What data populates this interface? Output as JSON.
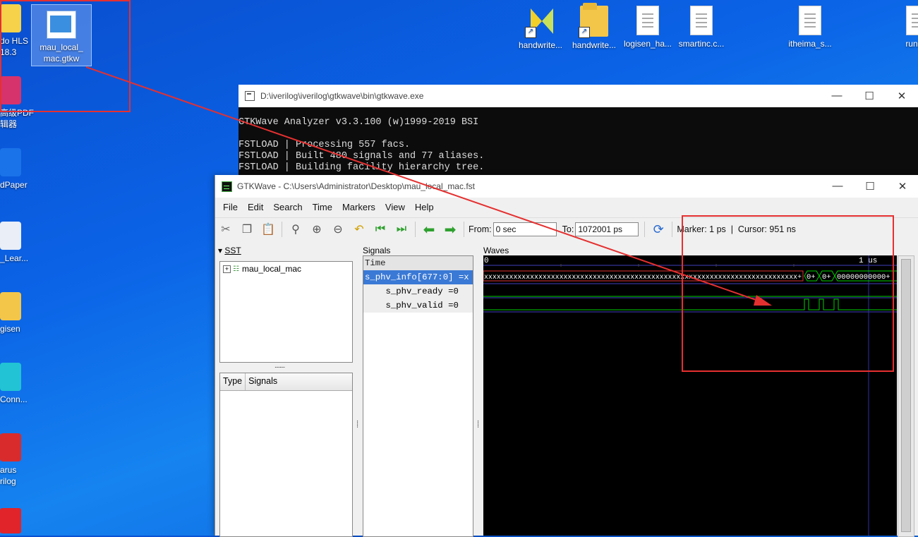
{
  "desktop": {
    "left_edge_icons": [
      {
        "label": "do HLS\n18.3",
        "color": "#f5d24a"
      },
      {
        "label": "高级PDF\n辑器",
        "color": "#d6336c"
      },
      {
        "label": "dPaper",
        "color": "#1a73e8"
      },
      {
        "label": "_Lear...",
        "color": "#e9eef7"
      },
      {
        "label": "gisen",
        "color": "#f3c64a"
      },
      {
        "label": "Conn...",
        "color": "#22c3d4"
      },
      {
        "label": "arus\nrilog",
        "color": "#d92b2b"
      }
    ],
    "selected_icon": {
      "label": "mau_local_\nmac.gtkw"
    },
    "top_icons": [
      {
        "label": "handwrite...",
        "kind": "app"
      },
      {
        "label": "handwrite...",
        "kind": "folder"
      },
      {
        "label": "logisen_ha...",
        "kind": "doc"
      },
      {
        "label": "smartinc.c...",
        "kind": "doc"
      },
      {
        "label": "itheima_s...",
        "kind": "doc"
      },
      {
        "label": "runabl",
        "kind": "doc"
      }
    ]
  },
  "console": {
    "title": "D:\\iverilog\\iverilog\\gtkwave\\bin\\gtkwave.exe",
    "lines": [
      "GTKWave Analyzer v3.3.100 (w)1999-2019 BSI",
      "",
      "FSTLOAD | Processing 557 facs.",
      "FSTLOAD | Built 480 signals and 77 aliases.",
      "FSTLOAD | Building facility hierarchy tree."
    ]
  },
  "gtkwave": {
    "title": "GTKWave - C:\\Users\\Administrator\\Desktop\\mau_local_mac.fst",
    "menu": [
      "File",
      "Edit",
      "Search",
      "Time",
      "Markers",
      "View",
      "Help"
    ],
    "toolbar": {
      "from_label": "From:",
      "from_value": "0 sec",
      "to_label": "To:",
      "to_value": "1072001 ps",
      "marker_text": "Marker: 1 ps  |  Cursor: 951 ns"
    },
    "sst": {
      "label": "SST",
      "tree_root": "mau_local_mac",
      "type_header": "Type",
      "signals_header": "Signals"
    },
    "signals": {
      "label": "Signals",
      "rows": [
        {
          "text": "Time",
          "style": "time"
        },
        {
          "text": "s_phv_info[677:0] =x",
          "style": "sel"
        },
        {
          "text": "    s_phv_ready =0",
          "style": "alt"
        },
        {
          "text": "    s_phv_valid =0",
          "style": "alt"
        }
      ]
    },
    "waves": {
      "label": "Waves",
      "time_start": "0",
      "time_mark": "1 us",
      "bus_text": "xxxxxxxxxxxxxxxxxxxxxxxxxxxxxxxxxxxxxxxxxxxxxxxxxxxxxxxxxxxxxxxxxxxxxxxxxxx+",
      "bus_seg2": "0+",
      "bus_seg3": "0+",
      "bus_seg4": "00000000000+"
    }
  },
  "annotation_color": "#e53030"
}
